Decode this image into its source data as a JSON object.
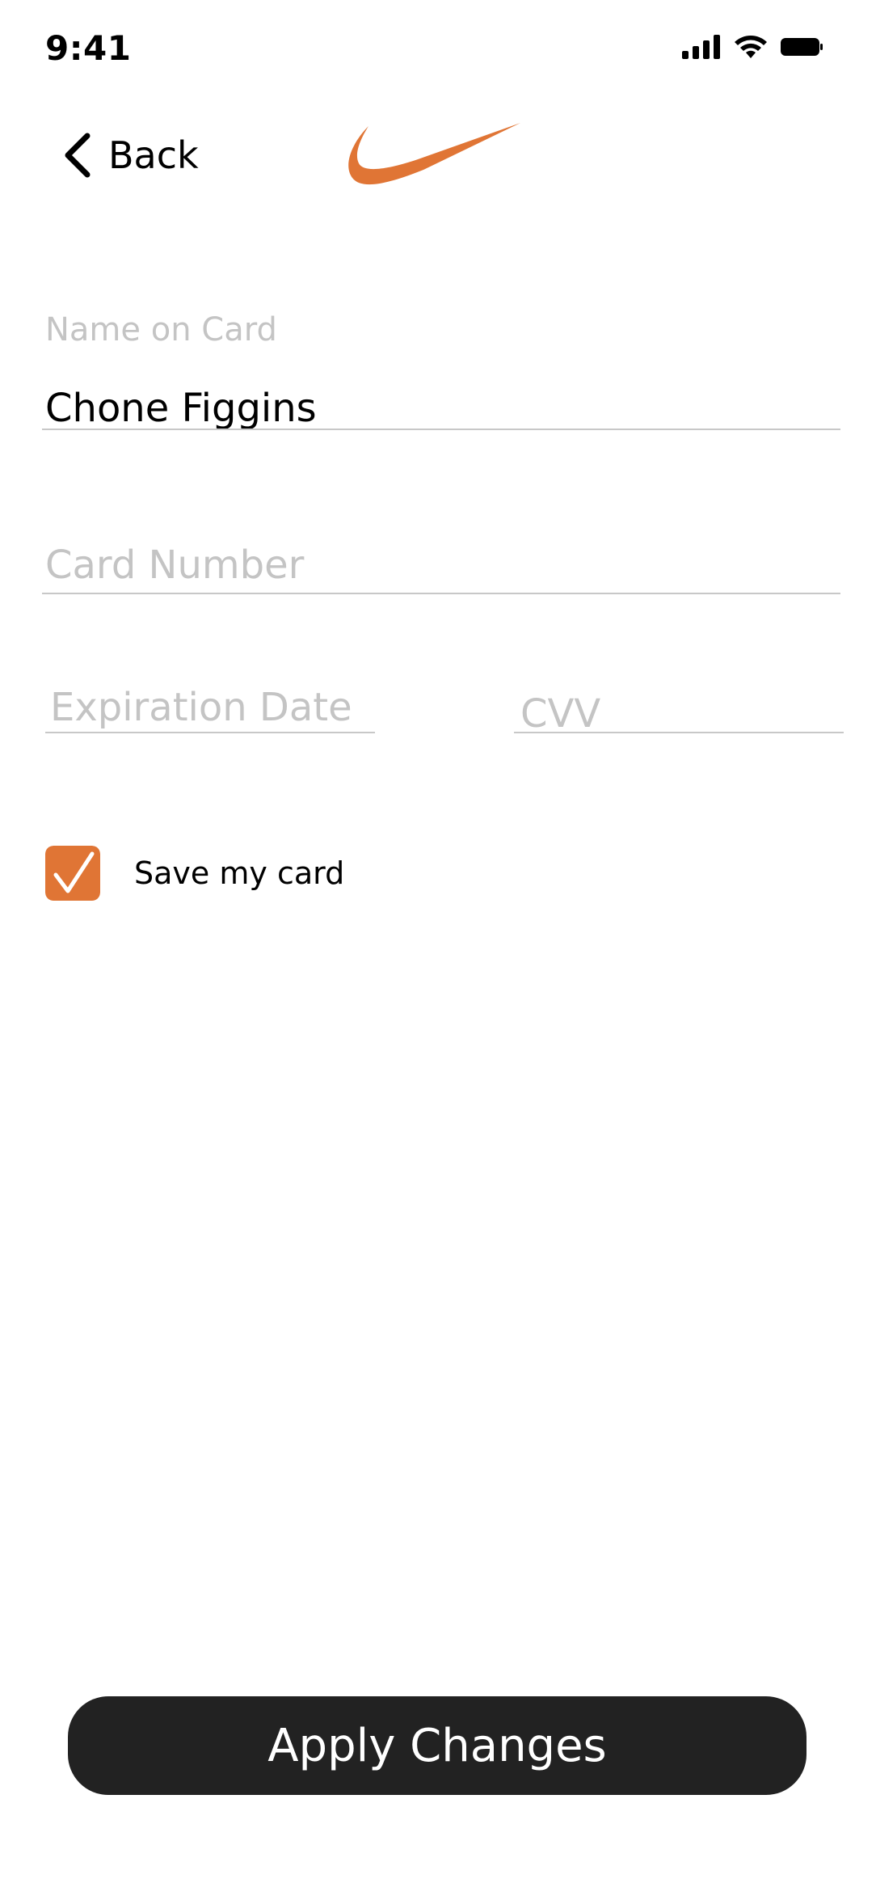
{
  "status_bar": {
    "time": "9:41"
  },
  "nav": {
    "back_label": "Back",
    "logo_icon": "swoosh-logo",
    "back_icon": "chevron-left-icon"
  },
  "form": {
    "name_label": "Name on Card",
    "name_value": "Chone Figgins",
    "card_number_placeholder": "Card Number",
    "expiration_placeholder": "Expiration Date",
    "cvv_placeholder": "CVV"
  },
  "save_card": {
    "label": "Save my card",
    "checked": true
  },
  "apply_button": {
    "label": "Apply Changes"
  },
  "colors": {
    "accent": "#E07535",
    "button_bg": "#222222",
    "placeholder": "#C4C4C4"
  }
}
